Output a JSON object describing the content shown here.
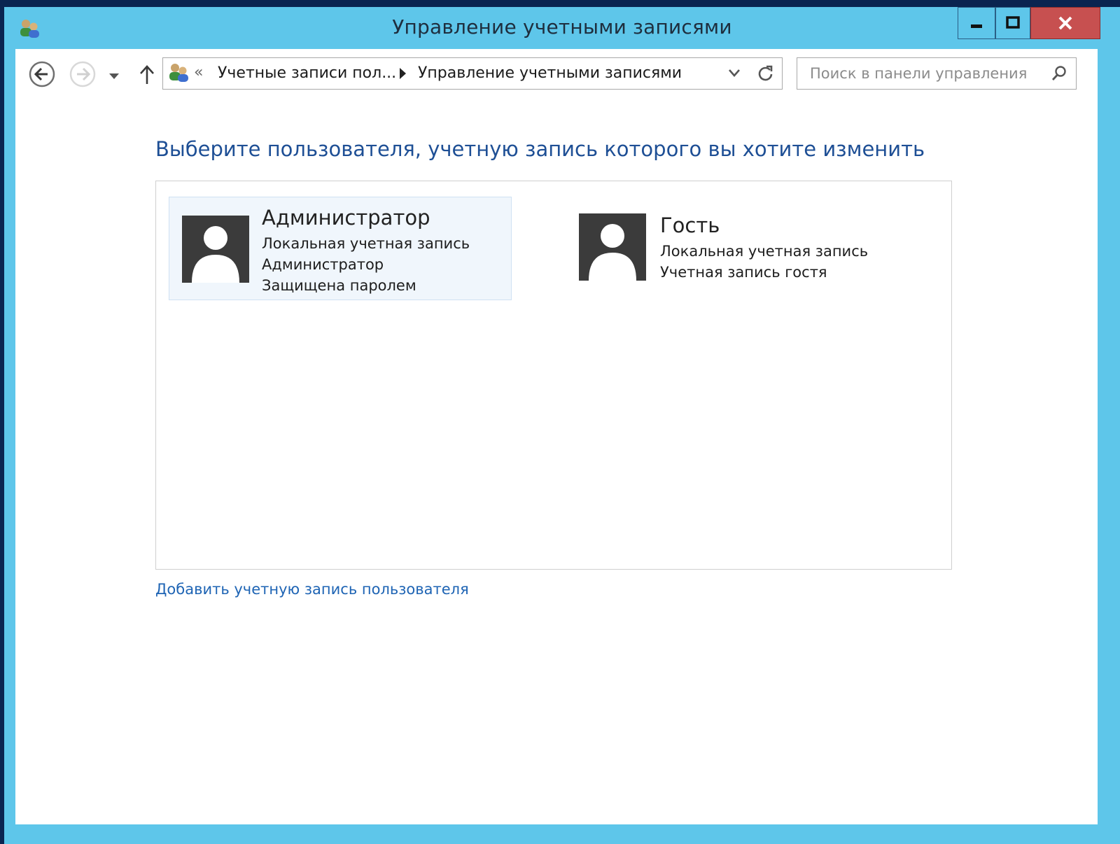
{
  "window": {
    "title": "Управление учетными записями"
  },
  "address_bar": {
    "overflow_chevron": "«",
    "crumbs": [
      "Учетные записи пол...",
      "Управление учетными записями"
    ]
  },
  "search": {
    "placeholder": "Поиск в панели управления"
  },
  "main": {
    "heading": "Выберите пользователя, учетную запись которого вы хотите изменить",
    "accounts": [
      {
        "name": "Администратор",
        "lines": [
          "Локальная учетная запись",
          "Администратор",
          "Защищена паролем"
        ],
        "selected": true
      },
      {
        "name": "Гость",
        "lines": [
          "Локальная учетная запись",
          "Учетная запись гостя"
        ],
        "selected": false
      }
    ],
    "add_link": "Добавить учетную запись пользователя"
  },
  "colors": {
    "window_frame": "#5ec6ea",
    "close_button": "#c75050",
    "heading": "#1e4f95",
    "link": "#1e64b4",
    "avatar": "#3b3b3b",
    "selection": "#f0f6fc"
  }
}
